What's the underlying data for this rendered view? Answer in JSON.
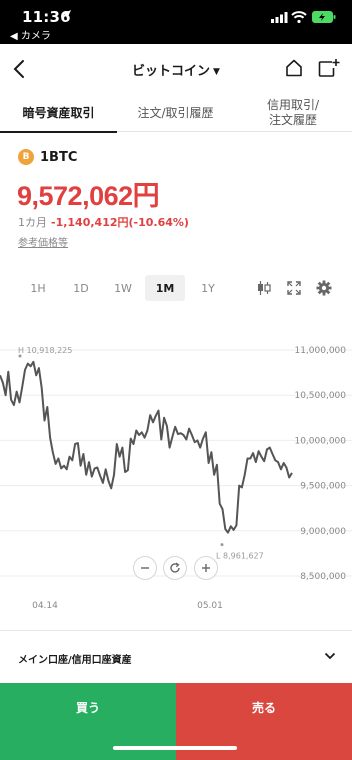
{
  "status_bar": {
    "time": "11:36",
    "back_app": "◀ カメラ"
  },
  "nav": {
    "title": "ビットコイン",
    "caret": "▼"
  },
  "tabs": [
    {
      "label": "暗号資産取引"
    },
    {
      "label": "注文/取引履歴"
    },
    {
      "label": "信用取引/\n注文履歴"
    }
  ],
  "asset": {
    "coin_glyph": "B",
    "symbol": "1BTC",
    "price": "9,572,062円",
    "change_period": "1カ月",
    "change_value": "-1,140,412円(-10.64%)",
    "reference_link": "参考価格等"
  },
  "ranges": [
    "1H",
    "1D",
    "1W",
    "1M",
    "1Y"
  ],
  "active_range": "1M",
  "chart_data": {
    "type": "line",
    "ylim": [
      8500000,
      11000000
    ],
    "yticks": [
      "11,000,000",
      "10,500,000",
      "10,000,000",
      "9,500,000",
      "9,000,000",
      "8,500,000"
    ],
    "x_ticks": [
      "04.14",
      "05.01"
    ],
    "high_label": "H 10,918,225",
    "low_label": "L 8,961,627",
    "series": [
      {
        "values": [
          10720000,
          10640000,
          10500000,
          10760000,
          10450000,
          10390000,
          10540000,
          10420000,
          10590000,
          10780000,
          10850000,
          10820000,
          10870000,
          10720000,
          10800000,
          10580000,
          10220000,
          10370000,
          10030000,
          9870000,
          9740000,
          9800000,
          9690000,
          9720000,
          9680000,
          9820000,
          9780000,
          9960000,
          9970000,
          9720000,
          9850000,
          9620000,
          9760000,
          9600000,
          9690000,
          9700000,
          9610000,
          9530000,
          9680000,
          9550000,
          9470000,
          9620000,
          9960000,
          9820000,
          9920000,
          9650000,
          9670000,
          10020000,
          9960000,
          10110000,
          10060000,
          10090000,
          10030000,
          10110000,
          10280000,
          10200000,
          10270000,
          10330000,
          10010000,
          10250000,
          10160000,
          9920000,
          10040000,
          10150000,
          10070000,
          10080000,
          10060000,
          10010000,
          10130000,
          10060000,
          9980000,
          10000000,
          9920000,
          10020000,
          10090000,
          9750000,
          9870000,
          9620000,
          9730000,
          9300000,
          9240000,
          9020000,
          8980000,
          9050000,
          9010000,
          9060000,
          9500000,
          9480000,
          9620000,
          9800000,
          9800000,
          9860000,
          9760000,
          9880000,
          9820000,
          9770000,
          9900000,
          9920000,
          9850000,
          9780000,
          9760000,
          9680000,
          9750000,
          9700000,
          9590000,
          9640000
        ]
      }
    ]
  },
  "account": {
    "label": "メイン口座/信用口座資産"
  },
  "actions": {
    "buy": "買う",
    "sell": "売る"
  },
  "colors": {
    "buy": "#27ae60",
    "sell": "#d9473f",
    "price": "#e04040",
    "line": "#555555",
    "coin": "#f0a23b"
  },
  "icons": [
    "location-arrow-icon",
    "signal-icon",
    "wifi-icon",
    "battery-charging-icon",
    "back-chevron-icon",
    "home-icon",
    "add-window-icon",
    "candlestick-icon",
    "fullscreen-icon",
    "gear-icon",
    "zoom-out-icon",
    "refresh-icon",
    "zoom-in-icon",
    "chevron-down-icon"
  ]
}
